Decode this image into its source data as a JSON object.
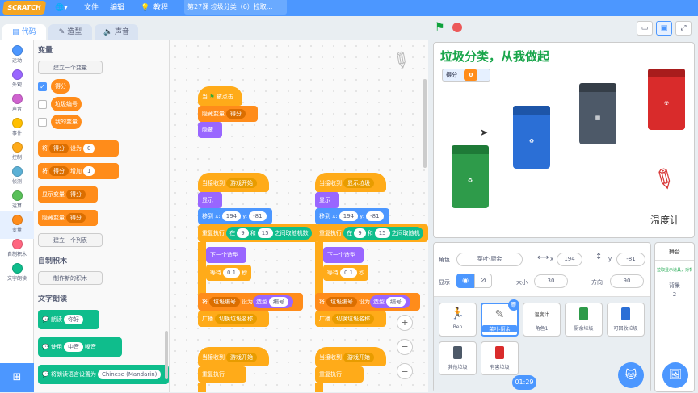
{
  "topbar": {
    "logo": "SCRATCH",
    "globe_icon": "globe-icon",
    "file_menu": "文件",
    "edit_menu": "编辑",
    "tutorials": "教程",
    "project_title": "第27课 垃圾分类（6）拉取..."
  },
  "tabs": [
    {
      "label": "代码",
      "icon": "code-icon"
    },
    {
      "label": "造型",
      "icon": "brush-icon"
    },
    {
      "label": "声音",
      "icon": "speaker-icon"
    }
  ],
  "categories": [
    {
      "label": "运动",
      "color": "#4c97ff"
    },
    {
      "label": "外观",
      "color": "#9966ff"
    },
    {
      "label": "声音",
      "color": "#cf63cf"
    },
    {
      "label": "事件",
      "color": "#ffbf00"
    },
    {
      "label": "控制",
      "color": "#ffab19"
    },
    {
      "label": "侦测",
      "color": "#5cb1d6"
    },
    {
      "label": "运算",
      "color": "#59c059"
    },
    {
      "label": "变量",
      "color": "#ff8c1a"
    },
    {
      "label": "自制积木",
      "color": "#ff6680"
    },
    {
      "label": "文字朗读",
      "color": "#0fbd8c"
    }
  ],
  "palette": {
    "variables_title": "变量",
    "make_variable": "建立一个变量",
    "var_score": "得分",
    "var_trash_id": "垃圾编号",
    "var_mine": "我的变量",
    "set_block": {
      "prefix": "将",
      "var": "得分",
      "mid": "设为",
      "value": "0"
    },
    "change_block": {
      "prefix": "将",
      "var": "得分",
      "mid": "增加",
      "value": "1"
    },
    "show_var": {
      "prefix": "显示变量",
      "var": "得分"
    },
    "hide_var": {
      "prefix": "隐藏变量",
      "var": "得分"
    },
    "make_list": "建立一个列表",
    "myblocks_title": "自制积木",
    "make_block": "制作新的积木",
    "tts_title": "文字朗读",
    "speak": {
      "prefix": "朗读",
      "value": "你好"
    },
    "voice": {
      "prefix": "使用",
      "value": "中音",
      "suffix": "嗓音"
    },
    "lang": {
      "prefix": "将朗读语言设置为",
      "value": "Chinese (Mandarin)"
    }
  },
  "scripts": {
    "s1": {
      "hat_a": "当",
      "hat_b": "被点击",
      "hide_var": "隐藏变量",
      "hide_var_arg": "得分",
      "hide": "隐藏"
    },
    "s2": {
      "recv": "当接收到",
      "recv_arg": "游戏开始",
      "show": "显示",
      "goto": "移到 x:",
      "x": "194",
      "ylbl": "y:",
      "y": "-81",
      "forever": "重复执行",
      "ifa": "在",
      "r1": "9",
      "and": "和",
      "r2": "15",
      "rand_suffix": "之间取随机数",
      "next": "下一个造型",
      "wait": "等待",
      "wait_v": "0.1",
      "sec": "秒",
      "set": "将",
      "set_var": "垃圾编号",
      "set_to": "设为",
      "costume": "造型",
      "costume_arg": "编号",
      "broadcast": "广播",
      "broadcast_arg": "切换垃圾名称"
    },
    "s3": {
      "recv": "当接收到",
      "recv_arg": "显示垃圾",
      "show": "显示",
      "goto": "移到 x:",
      "x": "194",
      "ylbl": "y:",
      "y": "-81",
      "forever": "重复执行",
      "ifa": "在",
      "r1": "9",
      "and": "和",
      "r2": "15",
      "rand_suffix": "之间取随机",
      "next": "下一个造型",
      "wait": "等待",
      "wait_v": "0.1",
      "sec": "秒",
      "set": "将",
      "set_var": "垃圾编号",
      "set_to": "设为",
      "costume": "造型",
      "costume_arg": "编号",
      "broadcast": "广播",
      "broadcast_arg": "切换垃圾名称"
    },
    "s4": {
      "recv": "当接收到",
      "recv_arg": "游戏开始",
      "forever": "重复执行"
    },
    "s5": {
      "recv": "当接收到",
      "recv_arg": "游戏开始",
      "forever": "重复执行"
    }
  },
  "zoom": {
    "in": "+",
    "out": "−",
    "reset": "="
  },
  "stage": {
    "title": "垃圾分类，从我做起",
    "score_label": "得分",
    "score_value": "0",
    "thermo_label": "温度计",
    "bins": [
      {
        "color": "#2e9b4a",
        "label": "厨余垃圾"
      },
      {
        "color": "#2b6fd6",
        "label": "可回收物"
      },
      {
        "color": "#4d5968",
        "label": "其他垃圾"
      },
      {
        "color": "#d92b2b",
        "label": "有害垃圾"
      }
    ]
  },
  "sprite_info": {
    "sprite_label": "角色",
    "sprite_name": "菜叶-厨余",
    "x_label": "x",
    "x": "194",
    "y_label": "y",
    "y": "-81",
    "show_label": "显示",
    "size_label": "大小",
    "size": "30",
    "dir_label": "方向",
    "dir": "90"
  },
  "sprites": [
    {
      "name": "Ben"
    },
    {
      "name": "菜叶-厨余"
    },
    {
      "name": "角色1"
    },
    {
      "name": "厨余垃圾"
    },
    {
      "name": "可回收垃圾"
    },
    {
      "name": "其他垃圾"
    },
    {
      "name": "有害垃圾"
    }
  ],
  "stage_pane": {
    "title": "舞台",
    "note": "拉取显示道具，对背景进行",
    "bg_label": "背景",
    "bg_count": "2"
  },
  "timer": "01:29"
}
